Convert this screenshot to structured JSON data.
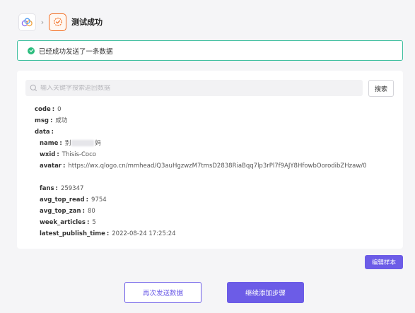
{
  "header": {
    "app_icon": "cloud-logo-icon",
    "step_icon": "check-badge-icon",
    "separator": "›",
    "title": "测试成功"
  },
  "banner": {
    "icon": "check-circle-icon",
    "text": "已经成功发送了一条数据",
    "color": "#3fbf9f"
  },
  "search": {
    "placeholder": "输入关键字搜索返回数据",
    "button_label": "搜索"
  },
  "result": {
    "code": {
      "key": "code",
      "value": "0"
    },
    "msg": {
      "key": "msg",
      "value": "成功"
    },
    "data": {
      "key": "data"
    },
    "fields": {
      "name": {
        "key": "name",
        "value_prefix": "别",
        "value_suffix": "妈"
      },
      "wxid": {
        "key": "wxid",
        "value": "Thisis-Coco"
      },
      "avatar": {
        "key": "avatar",
        "value": "https://wx.qlogo.cn/mmhead/Q3auHgzwzM7tmsD2838RiaBqq7lp3rPl7f9AJY8HfowbOorodibZHzaw/0"
      },
      "fans": {
        "key": "fans",
        "value": "259347"
      },
      "avg_top_read": {
        "key": "avg_top_read",
        "value": "9754"
      },
      "avg_top_zan": {
        "key": "avg_top_zan",
        "value": "80"
      },
      "week_articles": {
        "key": "week_articles",
        "value": "5"
      },
      "latest_publish_time": {
        "key": "latest_publish_time",
        "value": "2022-08-24 17:25:24"
      }
    }
  },
  "actions": {
    "edit_sample": "编辑样本",
    "resend": "再次发送数据",
    "continue": "继续添加步骤"
  },
  "colors": {
    "accent": "#6c5ce7",
    "success": "#2bbd7e",
    "step_active": "#f26d21"
  }
}
